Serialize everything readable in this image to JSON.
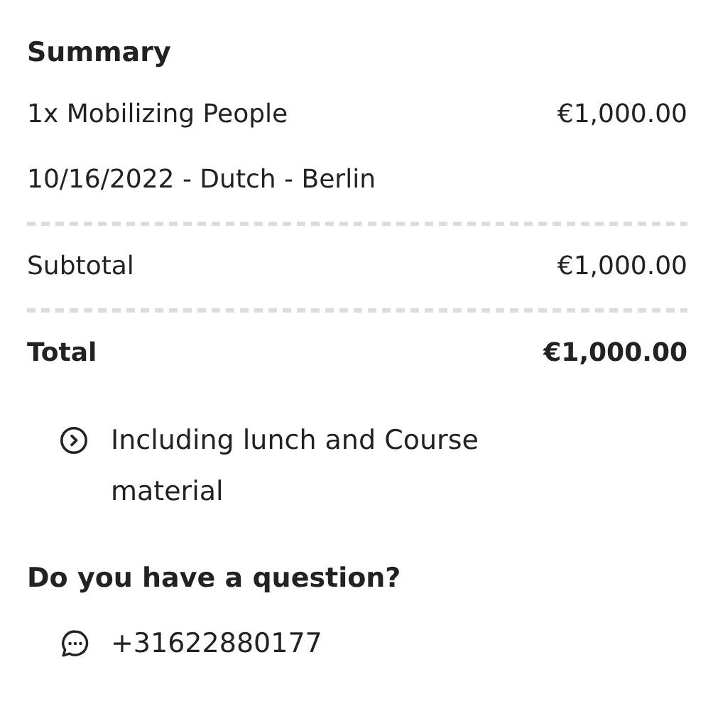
{
  "summary": {
    "title": "Summary",
    "lines": [
      {
        "kind": "item",
        "label": "1x Mobilizing People",
        "amount": "€1,000.00"
      },
      {
        "kind": "detail",
        "label": "10/16/2022 - Dutch - Berlin"
      },
      {
        "kind": "divider"
      },
      {
        "kind": "subtotal",
        "label": "Subtotal",
        "amount": "€1,000.00"
      },
      {
        "kind": "divider"
      },
      {
        "kind": "total",
        "label": "Total",
        "amount": "€1,000.00"
      }
    ],
    "feature": "Including lunch and Course material"
  },
  "contact": {
    "title": "Do you have a question?",
    "phone": "+31622880177"
  }
}
